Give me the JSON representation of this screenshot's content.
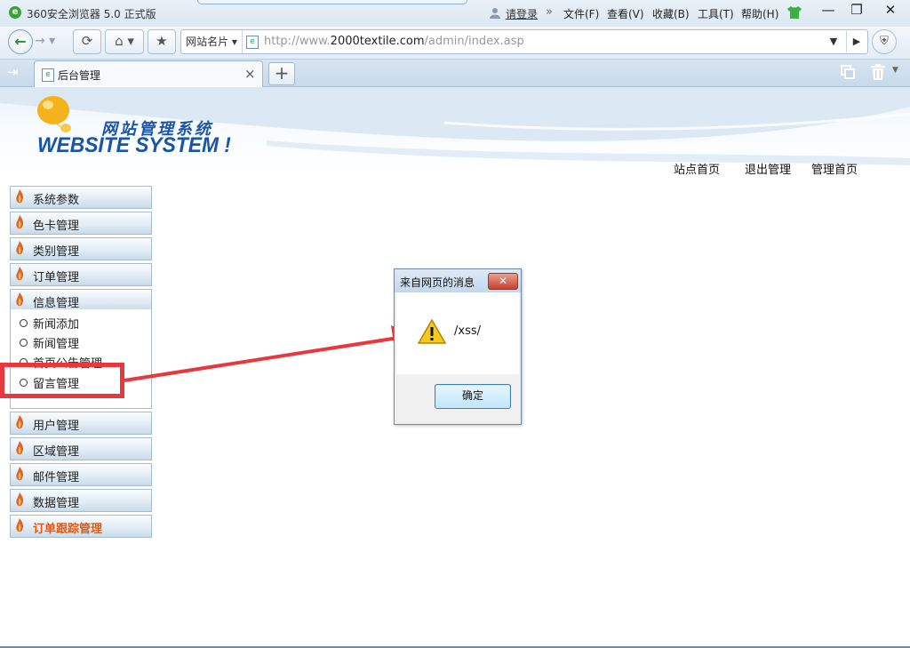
{
  "window": {
    "app_title": "360安全浏览器 5.0 正式版",
    "login_link": "请登录",
    "menu_sep": "»",
    "menu": [
      "文件(F)",
      "查看(V)",
      "收藏(B)",
      "工具(T)",
      "帮助(H)"
    ],
    "minimize": "—",
    "restore": "❐",
    "close": "✕"
  },
  "toolbar": {
    "back": "←",
    "forward": "→ ▾",
    "refresh": "⟳",
    "home": "⌂ ▾",
    "favorite": "★",
    "site_card": "网站名片 ▾",
    "url_prefix": "http://www.",
    "url_domain": "2000textile.com",
    "url_path": "/admin/index.asp",
    "addr_dropdown": "▼",
    "go": "▶",
    "shield": "⛨"
  },
  "tabs": {
    "sidebar_toggle": "⇥",
    "active_tab": "后台管理",
    "close": "×",
    "new_tab": "+",
    "trash_dropdown": "▼"
  },
  "header": {
    "title_cn": "网站管理系统",
    "title_en": "WEBSITE SYSTEM !",
    "links": [
      "站点首页",
      "退出管理",
      "管理首页"
    ]
  },
  "sidebar": {
    "groups_top": [
      "系统参数",
      "色卡管理",
      "类别管理",
      "订单管理",
      "信息管理"
    ],
    "sub_items": [
      "新闻添加",
      "新闻管理",
      "首页公告管理",
      "留言管理"
    ],
    "groups_bottom": [
      "用户管理",
      "区域管理",
      "邮件管理",
      "数据管理",
      "订单跟踪管理"
    ],
    "highlighted_group": "订单跟踪管理",
    "highlight_color": "#e05a10"
  },
  "annotation": {
    "color": "#e8373d"
  },
  "dialog": {
    "title": "来自网页的消息",
    "close": "✕",
    "message": "/xss/",
    "ok": "确定"
  }
}
